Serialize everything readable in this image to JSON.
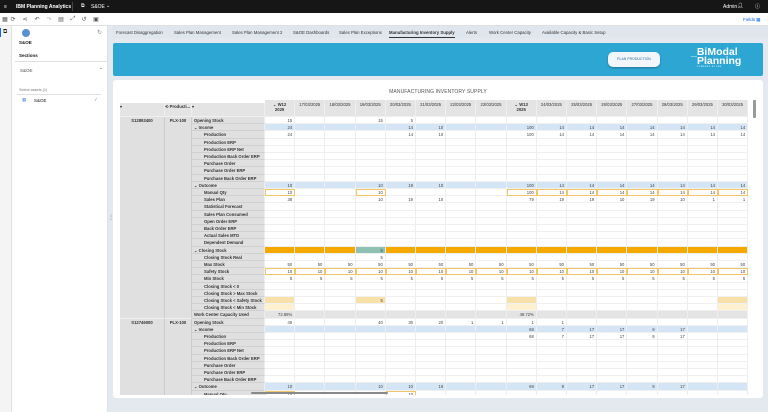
{
  "topbar": {
    "app_title": "IBM Planning Analytics",
    "workspace": "S&OE",
    "user": "Admin"
  },
  "toolbar": {
    "fields_label": "Fields"
  },
  "sidebar": {
    "title": "S&OE",
    "sections_label": "Sections",
    "section": "S&OE",
    "assets_label": "Select assets (1)",
    "asset": "S&OE"
  },
  "tabs": [
    {
      "label": "Forecast Disaggregation"
    },
    {
      "label": "Sales Plan Management"
    },
    {
      "label": "Sales Plan Management 2"
    },
    {
      "label": "S&OE Dashboards"
    },
    {
      "label": "Sales Plan Exceptions"
    },
    {
      "label": "Manufacturing Inventory Supply",
      "active": true
    },
    {
      "label": "Alerts"
    },
    {
      "label": "Work Center Capacity"
    },
    {
      "label": "Available Capacity & Basic Setup"
    }
  ],
  "banner": {
    "button": "PLAN PRODUCTION",
    "logo_line1": "_BiModal",
    "logo_line2": "Planning",
    "logo_tag": "POWERED BY IBM"
  },
  "report": {
    "title": "MANUFACTURING INVENTORY SUPPLY",
    "dim_header": "Producti...",
    "columns": [
      "W12\n2025",
      "17/03/2025",
      "18/03/2025",
      "19/03/2025",
      "20/03/2025",
      "21/03/2025",
      "22/03/2025",
      "23/03/2025",
      "W13\n2025",
      "24/03/2025",
      "25/03/2025",
      "26/03/2025",
      "27/03/2025",
      "28/03/2025",
      "29/03/2025",
      "30/03/2025"
    ],
    "products": [
      {
        "id": "S12893400",
        "family": "PLX-100",
        "rows": [
          {
            "label": "Opening Stock",
            "lvl": 0,
            "v": [
              "15",
              "",
              "",
              "15",
              "5",
              "",
              "",
              "",
              "",
              "",
              "",
              "",
              "",
              "",
              "",
              ""
            ]
          },
          {
            "label": "Income",
            "lvl": 1,
            "t": "group",
            "v": [
              "24",
              "",
              "",
              "",
              "14",
              "10",
              "",
              "",
              "100",
              "14",
              "14",
              "14",
              "14",
              "14",
              "14",
              "14"
            ]
          },
          {
            "label": "Production",
            "lvl": 2,
            "v": [
              "24",
              "",
              "",
              "",
              "14",
              "10",
              "",
              "",
              "100",
              "14",
              "14",
              "14",
              "14",
              "14",
              "14",
              "14"
            ]
          },
          {
            "label": "Production ERP",
            "lvl": 2
          },
          {
            "label": "Production ERP Net",
            "lvl": 2
          },
          {
            "label": "Production Back Order ERP",
            "lvl": 2
          },
          {
            "label": "Purchase Order",
            "lvl": 2
          },
          {
            "label": "Purchase Order ERP",
            "lvl": 2
          },
          {
            "label": "Purchase Back Order ERP",
            "lvl": 2
          },
          {
            "label": "Outcome",
            "lvl": 1,
            "t": "group",
            "v": [
              "10",
              "",
              "",
              "10",
              "19",
              "10",
              "",
              "",
              "100",
              "14",
              "14",
              "14",
              "14",
              "14",
              "14",
              "14"
            ]
          },
          {
            "label": "Manual Qty",
            "lvl": 2,
            "t": "input",
            "v": [
              "10",
              "",
              "",
              "10",
              "",
              "",
              "",
              "",
              "100",
              "14",
              "14",
              "14",
              "14",
              "14",
              "14",
              "14"
            ]
          },
          {
            "label": "Sales Plan",
            "lvl": 2,
            "v": [
              "38",
              "",
              "",
              "10",
              "19",
              "10",
              "",
              "",
              "79",
              "19",
              "19",
              "10",
              "19",
              "10",
              "1",
              "1"
            ]
          },
          {
            "label": "Statistical Forecast",
            "lvl": 2
          },
          {
            "label": "Sales Plan Consumed",
            "lvl": 2
          },
          {
            "label": "Open Order ERP",
            "lvl": 2
          },
          {
            "label": "Back Order ERP",
            "lvl": 2
          },
          {
            "label": "Actual Sales MTD",
            "lvl": 2
          },
          {
            "label": "Dependent Demand",
            "lvl": 2
          },
          {
            "label": "Closing Stock",
            "lvl": 1,
            "t": "closing",
            "v": [
              "",
              "",
              "",
              "5",
              "",
              "",
              "",
              "",
              "",
              "",
              "",
              "",
              "",
              "",
              "",
              ""
            ]
          },
          {
            "label": "Closing Stock Real",
            "lvl": 2,
            "v": [
              "",
              "",
              "",
              "5",
              "",
              "",
              "",
              "",
              "",
              "",
              "",
              "",
              "",
              "",
              "",
              ""
            ]
          },
          {
            "label": "Max Stock",
            "lvl": 2,
            "v": [
              "50",
              "50",
              "50",
              "50",
              "50",
              "50",
              "50",
              "50",
              "50",
              "50",
              "50",
              "50",
              "50",
              "50",
              "50",
              "50"
            ]
          },
          {
            "label": "Safety Stock",
            "lvl": 2,
            "t": "input",
            "v": [
              "10",
              "10",
              "10",
              "10",
              "10",
              "10",
              "10",
              "10",
              "10",
              "10",
              "10",
              "10",
              "10",
              "10",
              "10",
              "10"
            ]
          },
          {
            "label": "Min Stock",
            "lvl": 2,
            "v": [
              "5",
              "5",
              "5",
              "5",
              "5",
              "5",
              "5",
              "5",
              "5",
              "5",
              "5",
              "5",
              "5",
              "5",
              "5",
              "5"
            ]
          },
          {
            "label": "Closing Stock < 0",
            "lvl": 2
          },
          {
            "label": "Closing Stock > Max Stock",
            "lvl": 2
          },
          {
            "label": "Closing Stock < Safety Stock",
            "lvl": 2,
            "t": "safety",
            "v": [
              "",
              "",
              "",
              "5",
              "",
              "",
              "",
              "",
              "",
              "",
              "",
              "",
              "",
              "",
              "",
              ""
            ]
          },
          {
            "label": "Closing Stock < Min Stock",
            "lvl": 2,
            "t": "min"
          },
          {
            "label": "Work Center Capacity Used",
            "lvl": 0,
            "t": "wc",
            "v": [
              "72.88%",
              "",
              "",
              "",
              "",
              "",
              "",
              "",
              "49.72%",
              "",
              "",
              "",
              "",
              "",
              "",
              ""
            ]
          }
        ]
      },
      {
        "id": "S12746000",
        "family": "PLX-100",
        "rows": [
          {
            "label": "Opening Stock",
            "lvl": 0,
            "v": [
              "40",
              "",
              "",
              "40",
              "30",
              "20",
              "1",
              "1",
              "1",
              "1",
              "",
              "",
              "",
              "",
              "",
              ""
            ]
          },
          {
            "label": "Income",
            "lvl": 1,
            "t": "group",
            "v": [
              "",
              "",
              "",
              "",
              "",
              "",
              "",
              "",
              "68",
              "7",
              "17",
              "17",
              "9",
              "17",
              "",
              ""
            ]
          },
          {
            "label": "Production",
            "lvl": 2,
            "v": [
              "",
              "",
              "",
              "",
              "",
              "",
              "",
              "",
              "68",
              "7",
              "17",
              "17",
              "9",
              "17",
              "",
              ""
            ]
          },
          {
            "label": "Production ERP",
            "lvl": 2
          },
          {
            "label": "Production ERP Net",
            "lvl": 2
          },
          {
            "label": "Production Back Order ERP",
            "lvl": 2
          },
          {
            "label": "Purchase Order",
            "lvl": 2
          },
          {
            "label": "Purchase Order ERP",
            "lvl": 2
          },
          {
            "label": "Purchase Back Order ERP",
            "lvl": 2
          },
          {
            "label": "Outcome",
            "lvl": 1,
            "t": "group",
            "v": [
              "10",
              "",
              "",
              "10",
              "10",
              "19",
              "",
              "",
              "69",
              "9",
              "17",
              "17",
              "9",
              "17",
              "",
              ""
            ]
          },
          {
            "label": "Manual Qty",
            "lvl": 2,
            "t": "input",
            "v": [
              "10",
              "",
              "",
              "",
              "10",
              "",
              "",
              "",
              "",
              "",
              "",
              "",
              "",
              "",
              "",
              ""
            ]
          }
        ]
      }
    ]
  }
}
